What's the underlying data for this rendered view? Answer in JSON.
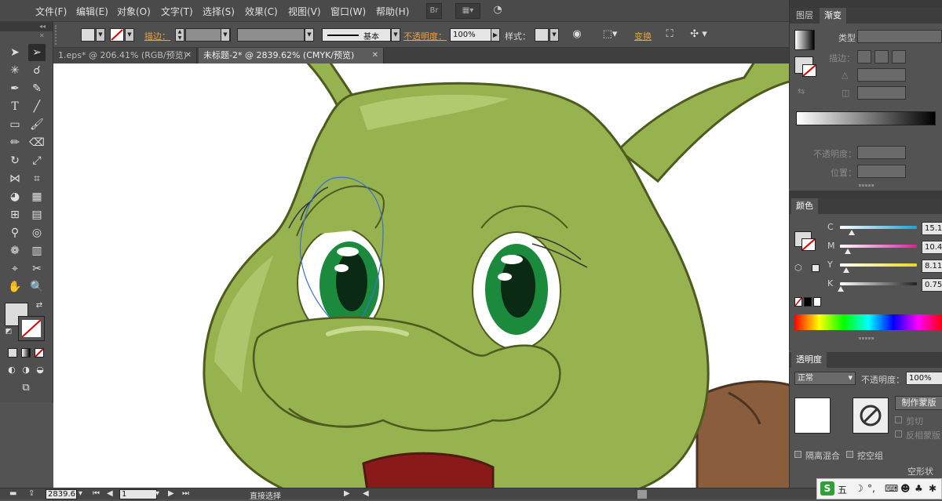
{
  "menu": [
    "文件(F)",
    "编辑(E)",
    "对象(O)",
    "文字(T)",
    "选择(S)",
    "效果(C)",
    "视图(V)",
    "窗口(W)",
    "帮助(H)"
  ],
  "menu_badge": "Br",
  "control": {
    "stroke_label": "描边：",
    "stroke_style": "基本",
    "opacity_label": "不透明度：",
    "opacity_value": "100%",
    "style_label": "样式：",
    "transform_label": "变换"
  },
  "tabs": [
    {
      "label": "1.eps* @ 206.41% (RGB/预览)",
      "close": "✕"
    },
    {
      "label": "未标题-2* @ 2839.62% (CMYK/预览)",
      "close": "✕"
    }
  ],
  "gradient_panel": {
    "tabs": [
      "图层",
      "渐变"
    ],
    "type_label": "类型：",
    "stroke_label": "描边：",
    "opacity_label": "不透明度：",
    "position_label": "位置："
  },
  "color_panel": {
    "title": "颜色",
    "channels": [
      {
        "label": "C",
        "value": "15.11",
        "fraction": 0.15,
        "color": "#1aa0d8"
      },
      {
        "label": "M",
        "value": "10.42",
        "fraction": 0.1,
        "color": "#d8209a"
      },
      {
        "label": "Y",
        "value": "8.11",
        "fraction": 0.08,
        "color": "#e8d820"
      },
      {
        "label": "K",
        "value": "0.75",
        "fraction": 0.01,
        "color": "#222222"
      }
    ]
  },
  "transparency_panel": {
    "title": "透明度",
    "blend_mode": "正常",
    "opacity_label": "不透明度：",
    "opacity_value": "100%",
    "make_mask_button": "制作蒙版",
    "clip_label": "剪切",
    "invert_label": "反相蒙版",
    "isolate_label": "隔离混合",
    "knockout_label": "挖空组",
    "shape_label": "空形状"
  },
  "status": {
    "zoom": "2839.6",
    "page": "1",
    "tool": "直接选择"
  },
  "ime": {
    "mode": "五"
  }
}
